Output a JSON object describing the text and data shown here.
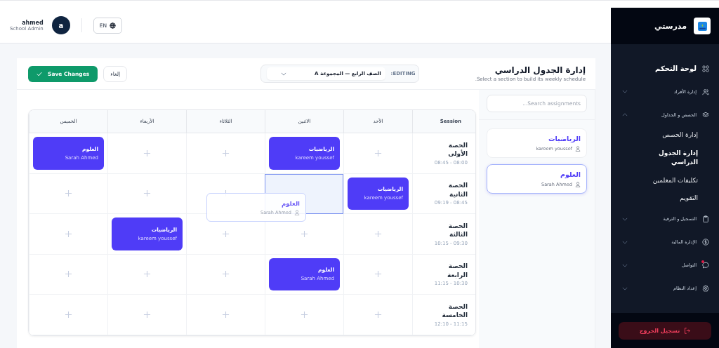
{
  "header": {
    "user_name": "ahmed",
    "user_role": "School Admin",
    "avatar": "a",
    "language": "EN"
  },
  "toolbar": {
    "title": "إدارة الجدول الدراسي",
    "subtitle": "Select a section to build its weekly schedule.",
    "editing_label": "EDITING:",
    "section": "الصف الرابع — المجموعة A",
    "cancel": "إلغاء",
    "save": "Save Changes"
  },
  "schedule": {
    "session_header": "Session",
    "days": [
      "الأحد",
      "الاثنين",
      "الثلاثاء",
      "الأربعاء",
      "الخميس"
    ],
    "rows": [
      {
        "session": "الحصة الأولى",
        "time": "08:45 - 08:00",
        "cells": [
          {
            "kind": "empty"
          },
          {
            "kind": "class",
            "subject": "الرياضيات",
            "teacher": "kareem youssef"
          },
          {
            "kind": "empty"
          },
          {
            "kind": "empty"
          },
          {
            "kind": "class",
            "subject": "العلوم",
            "teacher": "Sarah Ahmed"
          }
        ]
      },
      {
        "session": "الحصة الثانية",
        "time": "09:19 - 08:45",
        "cells": [
          {
            "kind": "class",
            "subject": "الرياضيات",
            "teacher": "kareem youssef"
          },
          {
            "kind": "empty",
            "drop_target": true
          },
          {
            "kind": "empty"
          },
          {
            "kind": "empty"
          },
          {
            "kind": "empty"
          }
        ]
      },
      {
        "session": "الحصة الثالثة",
        "time": "10:15 - 09:30",
        "cells": [
          {
            "kind": "empty"
          },
          {
            "kind": "empty"
          },
          {
            "kind": "empty"
          },
          {
            "kind": "class",
            "subject": "الرياضيات",
            "teacher": "kareem youssef"
          },
          {
            "kind": "empty"
          }
        ]
      },
      {
        "session": "الحصة الرابعة",
        "time": "11:15 - 10:30",
        "cells": [
          {
            "kind": "empty"
          },
          {
            "kind": "class",
            "subject": "العلوم",
            "teacher": "Sarah Ahmed"
          },
          {
            "kind": "empty"
          },
          {
            "kind": "empty"
          },
          {
            "kind": "empty"
          }
        ]
      },
      {
        "session": "الحصة الخامسة",
        "time": "12:10 - 11:15",
        "cells": [
          {
            "kind": "empty"
          },
          {
            "kind": "empty"
          },
          {
            "kind": "empty"
          },
          {
            "kind": "empty"
          },
          {
            "kind": "empty"
          }
        ]
      }
    ],
    "drag_preview": {
      "subject": "العلوم",
      "teacher": "Sarah Ahmed"
    }
  },
  "assignments": {
    "placeholder": "Search assignments...",
    "items": [
      {
        "subject": "الرياضيات",
        "teacher": "kareem youssef",
        "selected": false
      },
      {
        "subject": "العلوم",
        "teacher": "Sarah Ahmed",
        "selected": true
      }
    ]
  },
  "sidebar": {
    "brand": "مدرستي",
    "items": [
      {
        "kind": "link",
        "label": "لوحة التحكم"
      },
      {
        "kind": "group",
        "label": "إدارة الأفراد",
        "expanded": false
      },
      {
        "kind": "group",
        "label": "الحصص و الجداول",
        "expanded": true,
        "children": [
          {
            "label": "إدارة الحصص",
            "selected": false
          },
          {
            "label": "إدارة الجدول الدراسي",
            "selected": true
          },
          {
            "label": "تكليفات المعلمين",
            "selected": false
          },
          {
            "label": "التقويم",
            "selected": false
          }
        ]
      },
      {
        "kind": "group",
        "label": "التسجيل و الترقية",
        "expanded": false
      },
      {
        "kind": "group",
        "label": "الإدارة المالية",
        "expanded": false
      },
      {
        "kind": "group",
        "label": "التواصل",
        "expanded": false,
        "badge": true
      },
      {
        "kind": "group",
        "label": "إعداد النظام",
        "expanded": false
      }
    ],
    "logout": "تسجيل الخروج"
  }
}
